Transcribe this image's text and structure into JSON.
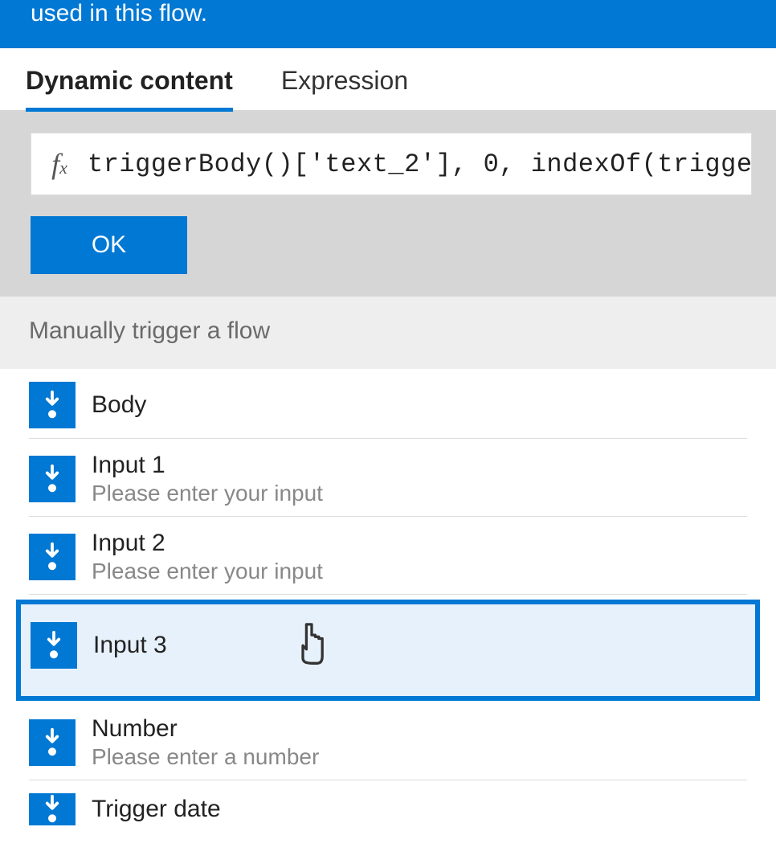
{
  "banner": {
    "text": "used in this flow."
  },
  "tabs": {
    "dynamic": "Dynamic content",
    "expression": "Expression",
    "active": "dynamic"
  },
  "expression": {
    "fx": "f",
    "fx_sub": "x",
    "text": "triggerBody()['text_2'], 0, indexOf(trigge",
    "ok": "OK"
  },
  "section": {
    "title": "Manually trigger a flow"
  },
  "items": [
    {
      "title": "Body",
      "desc": ""
    },
    {
      "title": "Input 1",
      "desc": "Please enter your input"
    },
    {
      "title": "Input 2",
      "desc": "Please enter your input"
    },
    {
      "title": "Input 3",
      "desc": "",
      "highlighted": true
    },
    {
      "title": "Number",
      "desc": "Please enter a number"
    },
    {
      "title": "Trigger date",
      "desc": ""
    }
  ]
}
